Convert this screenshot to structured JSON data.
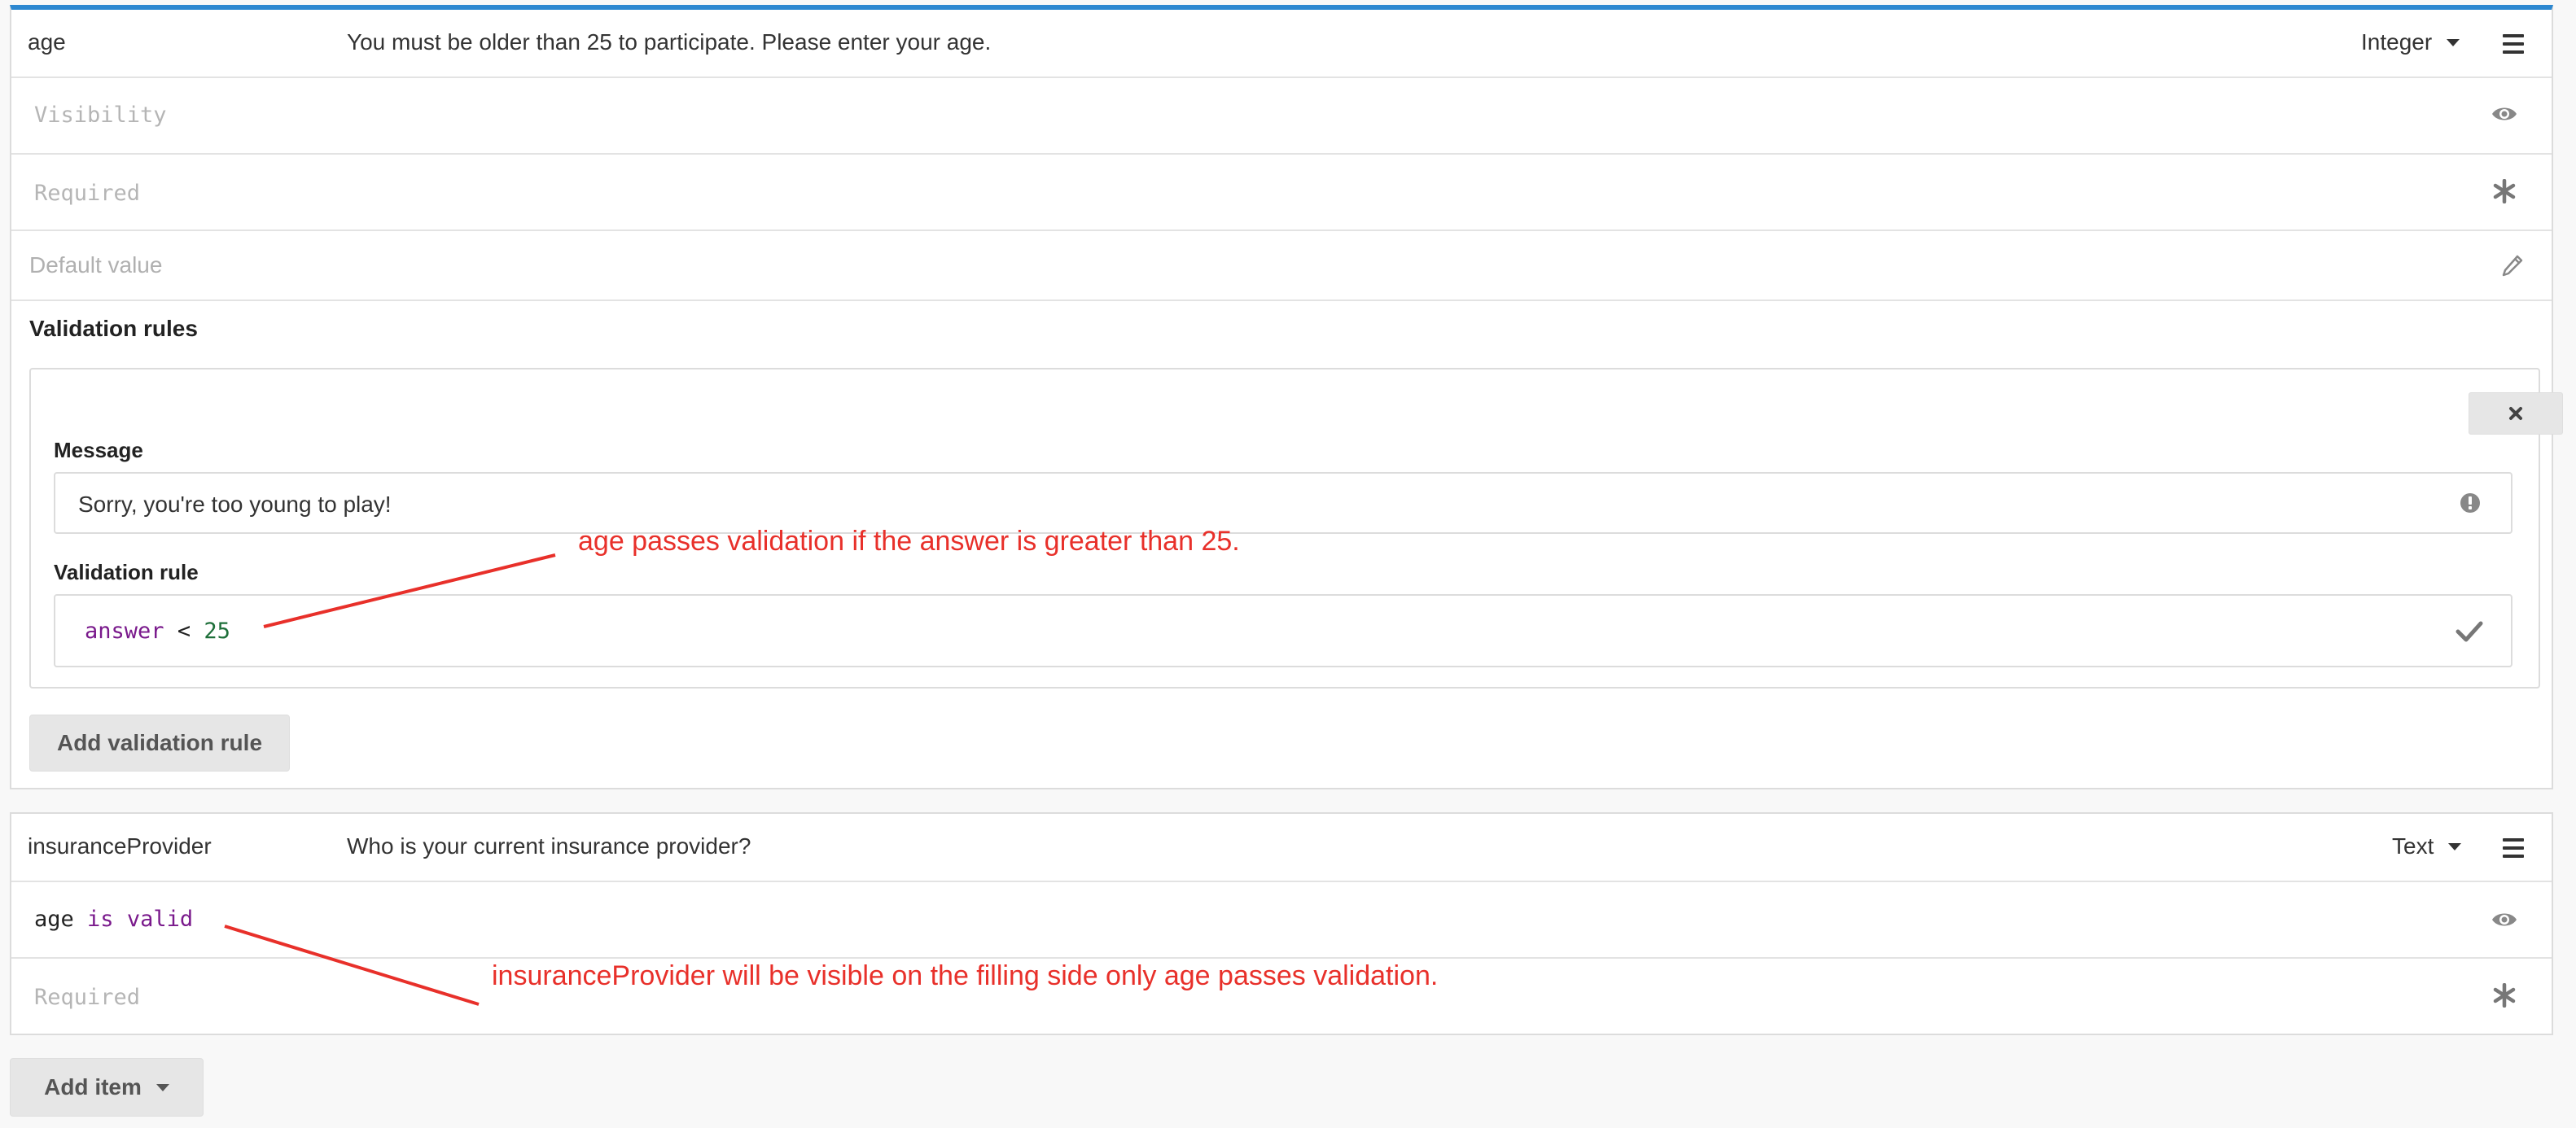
{
  "age_item": {
    "name": "age",
    "question": "You must be older than 25 to participate. Please enter your age.",
    "type": "Integer",
    "visibility_placeholder": "Visibility",
    "required_placeholder": "Required",
    "default_value_placeholder": "Default value",
    "validation_rules_heading": "Validation rules",
    "rule": {
      "message_label": "Message",
      "message_value": "Sorry, you're too young to play!",
      "validation_rule_label": "Validation rule",
      "expr_ident": "answer",
      "expr_op": "<",
      "expr_value": "25"
    },
    "add_validation_rule_label": "Add validation rule"
  },
  "insurance_item": {
    "name": "insuranceProvider",
    "question": "Who is your current insurance provider?",
    "type": "Text",
    "visibility_expr_ident": "age",
    "visibility_expr_keyword": "is valid",
    "required_placeholder": "Required"
  },
  "add_item_label": "Add item",
  "annotations": {
    "validation_note": "age passes validation if the answer is greater than 25.",
    "visibility_note": "insuranceProvider will be visible on the filling side only age passes validation."
  },
  "colors": {
    "accent_top_border": "#2c87d0",
    "annotation_red": "#e8302a",
    "keyword_purple": "#7a1a8c",
    "number_green": "#1e6f3a"
  },
  "icons": [
    "caret-down-icon",
    "menu-icon",
    "eye-icon",
    "asterisk-icon",
    "pencil-icon",
    "close-icon",
    "exclamation-circle-icon",
    "check-icon"
  ]
}
